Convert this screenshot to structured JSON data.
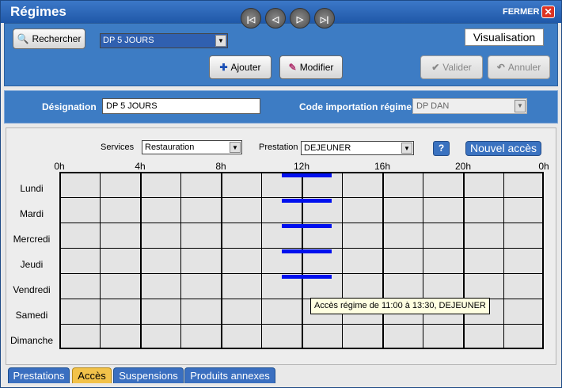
{
  "window": {
    "title": "Régimes",
    "close_label": "FERMER",
    "close_icon": "✕"
  },
  "toolbar": {
    "search_label": "Rechercher",
    "regime_select": "DP 5 JOURS",
    "nav": {
      "first": "|◁",
      "prev": "◁",
      "next": "▷",
      "last": "▷|"
    },
    "ajouter_label": "Ajouter",
    "modifier_label": "Modifier",
    "valider_label": "Valider",
    "annuler_label": "Annuler",
    "mode_label": "Visualisation"
  },
  "designation": {
    "label": "Désignation",
    "value": "DP 5 JOURS",
    "code_label": "Code importation régime",
    "code_value": "DP DAN"
  },
  "filters": {
    "services_label": "Services",
    "services_value": "Restauration",
    "prestation_label": "Prestation",
    "prestation_value": "DEJEUNER",
    "help_label": "?",
    "new_access_label": "Nouvel accès"
  },
  "schedule": {
    "hours": [
      "0h",
      "4h",
      "8h",
      "12h",
      "16h",
      "20h",
      "0h"
    ],
    "days": [
      "Lundi",
      "Mardi",
      "Mercredi",
      "Jeudi",
      "Vendredi",
      "Samedi",
      "Dimanche"
    ],
    "access": [
      {
        "day": "Lundi",
        "start": 11.0,
        "end": 13.5
      },
      {
        "day": "Mardi",
        "start": 11.0,
        "end": 13.5
      },
      {
        "day": "Mercredi",
        "start": 11.0,
        "end": 13.5
      },
      {
        "day": "Jeudi",
        "start": 11.0,
        "end": 13.5
      },
      {
        "day": "Vendredi",
        "start": 11.0,
        "end": 13.5
      }
    ],
    "bar_color": "#0010ee",
    "tooltip": "Accès régime de 11:00 à 13:30, DEJEUNER"
  },
  "tabs": [
    {
      "label": "Prestations",
      "active": false
    },
    {
      "label": "Accès",
      "active": true
    },
    {
      "label": "Suspensions",
      "active": false
    },
    {
      "label": "Produits annexes",
      "active": false
    }
  ]
}
